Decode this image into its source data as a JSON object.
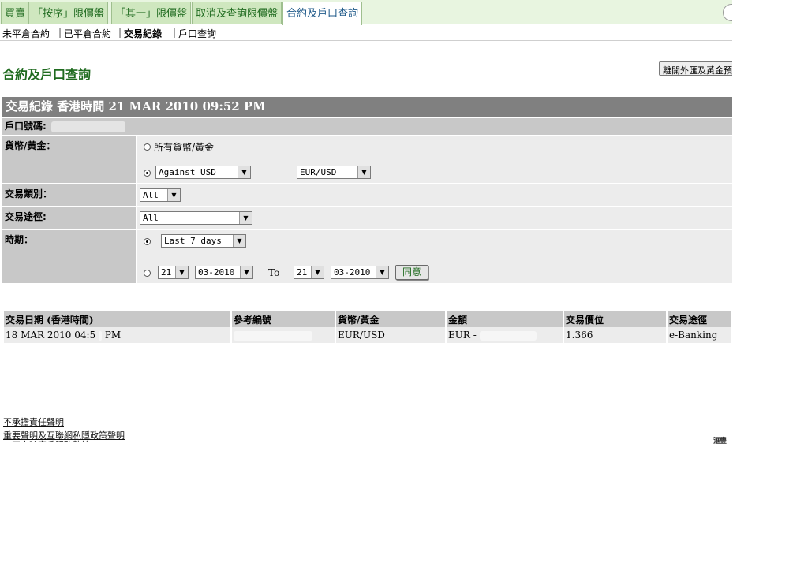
{
  "tabs": [
    {
      "label": "買賣"
    },
    {
      "label": "「按序」限價盤"
    },
    {
      "label": "「其一」限價盤"
    },
    {
      "label": "取消及查詢限價盤"
    },
    {
      "label": "合約及戶口查詢",
      "active": true
    }
  ],
  "subnav": [
    "未平倉合約",
    "已平倉合約",
    "交易紀錄",
    "戶口查詢"
  ],
  "subnav_separator": "|",
  "page_title": "合約及戶口查詢",
  "exit_button": "離開外匯及黃金預",
  "panel": {
    "title": "交易紀錄 香港時間 21 MAR 2010 09:52 PM",
    "account_label": "戶口號碼:",
    "currency_label": "貨幣/黃金：",
    "currency_all_option": "所有貨幣/黃金",
    "against_select": "Against USD",
    "pair_select": "EUR/USD",
    "txn_type_label": "交易類別：",
    "txn_type_value": "All",
    "channel_label": "交易途徑:",
    "channel_value": "All",
    "period_label": "時期：",
    "period_value": "Last 7 days",
    "from_day": "21",
    "from_month": "03-2010",
    "to_label": "To",
    "to_day": "21",
    "to_month": "03-2010",
    "agree_button": "同意"
  },
  "results": {
    "headers": [
      "交易日期 (香港時間)",
      "參考編號",
      "貨幣/黃金",
      "金額",
      "交易價位",
      "交易途徑"
    ],
    "rows": [
      {
        "date": "18 MAR 2010 04:5",
        "time_suffix": "PM",
        "currency": "EUR/USD",
        "amount": "EUR -",
        "price": "1.366",
        "channel": "e-Banking"
      }
    ]
  },
  "footer": {
    "disclaimer": "不承擔責任聲明",
    "privacy": "重要聲明及互聯網私隱政策聲明",
    "partial": "二四小時客戶服務熱線"
  },
  "footer_mark": "滙豐"
}
